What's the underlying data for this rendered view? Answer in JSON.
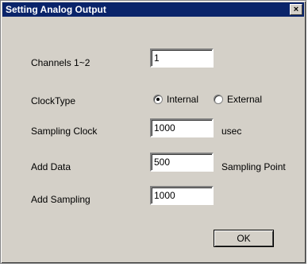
{
  "window": {
    "title": "Setting Analog Output",
    "close_glyph": "×"
  },
  "form": {
    "channels": {
      "label": "Channels  1~2",
      "value": "1"
    },
    "clock_type": {
      "label": "ClockType",
      "options": [
        {
          "label": "Internal",
          "selected": true
        },
        {
          "label": "External",
          "selected": false
        }
      ]
    },
    "sampling_clock": {
      "label": "Sampling Clock",
      "value": "1000",
      "unit": "usec"
    },
    "add_data": {
      "label": "Add Data",
      "value": "500",
      "unit": "Sampling Point"
    },
    "add_sampling": {
      "label": "Add Sampling",
      "value": "1000"
    }
  },
  "buttons": {
    "ok_label": "OK"
  }
}
